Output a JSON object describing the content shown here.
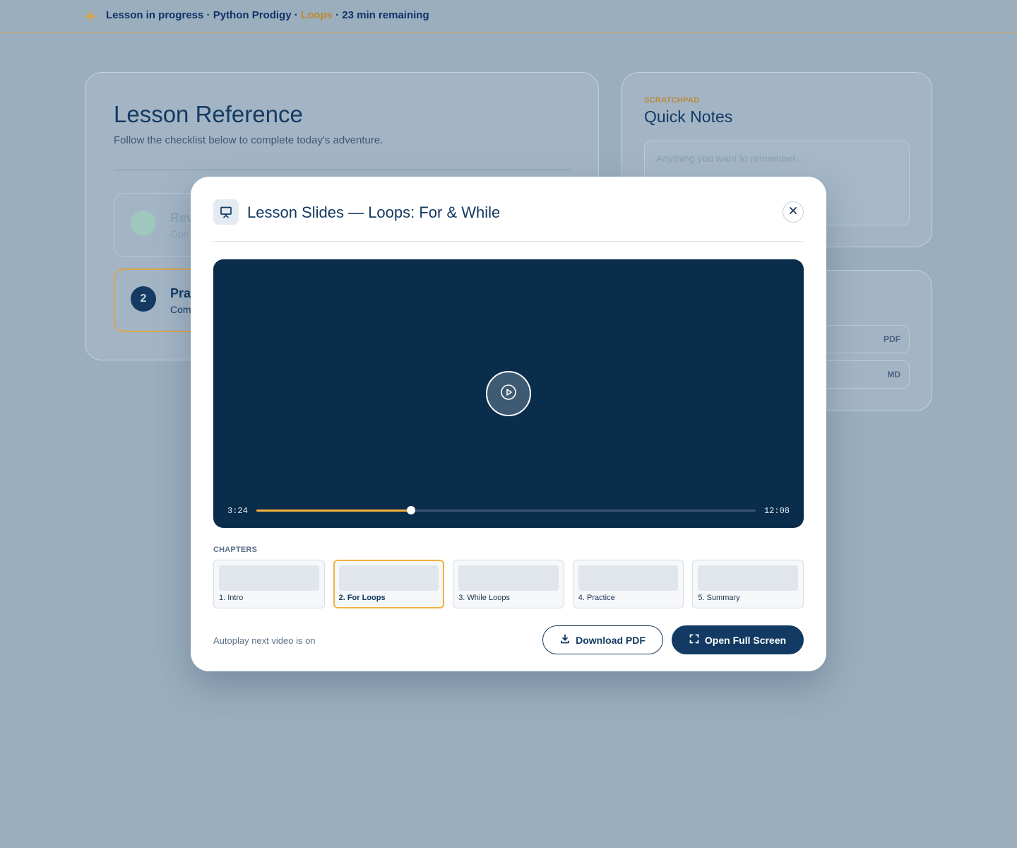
{
  "banner": {
    "icon": "sparkle-icon",
    "status": "Lesson in progress",
    "sep1": " · ",
    "course": "Python Prodigy",
    "sep2": " · ",
    "topic": "Loops",
    "sep3": " · ",
    "remaining": "23 min remaining",
    "accent_color": "#c08a2c"
  },
  "reference": {
    "title": "Lesson Reference",
    "subtitle": "Follow the checklist below to complete today's adventure.",
    "steps": [
      {
        "number": "",
        "title": "Rev",
        "desc": "Ope",
        "state": "completed"
      },
      {
        "number": "2",
        "title": "Pra",
        "desc": "Com",
        "state": "current"
      }
    ]
  },
  "notes": {
    "eyebrow": "SCRATCHPAD",
    "title": "Quick Notes",
    "placeholder": "Anything you want to remember..."
  },
  "resources": {
    "items": [
      {
        "tag": "PDF"
      },
      {
        "tag": "MD"
      }
    ]
  },
  "modal": {
    "icon": "presentation-icon",
    "title": "Lesson Slides — Loops: For & While",
    "close_icon": "close-icon",
    "player": {
      "current_time": "3:24",
      "total_time": "12:08",
      "progress_fraction": 0.31,
      "play_icon": "play-icon",
      "progress_color": "#f3b138"
    },
    "chapters_label": "CHAPTERS",
    "chapters": [
      {
        "label": "1. Intro",
        "active": false
      },
      {
        "label": "2. For Loops",
        "active": true
      },
      {
        "label": "3. While Loops",
        "active": false
      },
      {
        "label": "4. Practice",
        "active": false
      },
      {
        "label": "5. Summary",
        "active": false
      }
    ],
    "autoplay_text": "Autoplay next video is on",
    "download_label": "Download PDF",
    "download_icon": "download-icon",
    "fullscreen_label": "Open Full Screen",
    "fullscreen_icon": "fullscreen-icon"
  }
}
